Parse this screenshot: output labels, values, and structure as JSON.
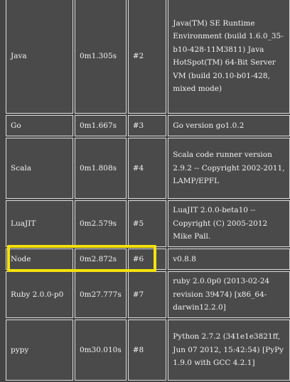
{
  "rows": [
    {
      "lang": "Java",
      "time": "0m1.305s",
      "rank": "#2",
      "version": "Java(TM) SE Runtime Environment (build 1.6.0_35-b10-428-11M3811) Java HotSpot(TM) 64-Bit Server VM (build 20.10-b01-428, mixed mode)"
    },
    {
      "lang": "Go",
      "time": "0m1.667s",
      "rank": "#3",
      "version": "Go version go1.0.2"
    },
    {
      "lang": "Scala",
      "time": "0m1.808s",
      "rank": "#4",
      "version": "Scala code runner version 2.9.2 -- Copyright 2002-2011, LAMP/EPFL"
    },
    {
      "lang": "LuaJIT",
      "time": "0m2.579s",
      "rank": "#5",
      "version": "LuaJIT 2.0.0-beta10 -- Copyright (C) 2005-2012 Mike Pall."
    },
    {
      "lang": "Node",
      "time": "0m2.872s",
      "rank": "#6",
      "version": "v0.8.8"
    },
    {
      "lang": "Ruby 2.0.0-p0",
      "time": "0m27.777s",
      "rank": "#7",
      "version": "ruby 2.0.0p0 (2013-02-24 revision 39474) [x86_64-darwin12.2.0]"
    },
    {
      "lang": "pypy",
      "time": "0m30.010s",
      "rank": "#8",
      "version": "Python 2.7.2 (341e1e3821ff, Jun 07 2012, 15:42:54) [PyPy 1.9.0 with GCC 4.2.1]"
    }
  ],
  "highlight_row": "Node",
  "colors": {
    "background": "#444444",
    "cell_border": "#dddddd",
    "highlight": "#f4e20c"
  }
}
